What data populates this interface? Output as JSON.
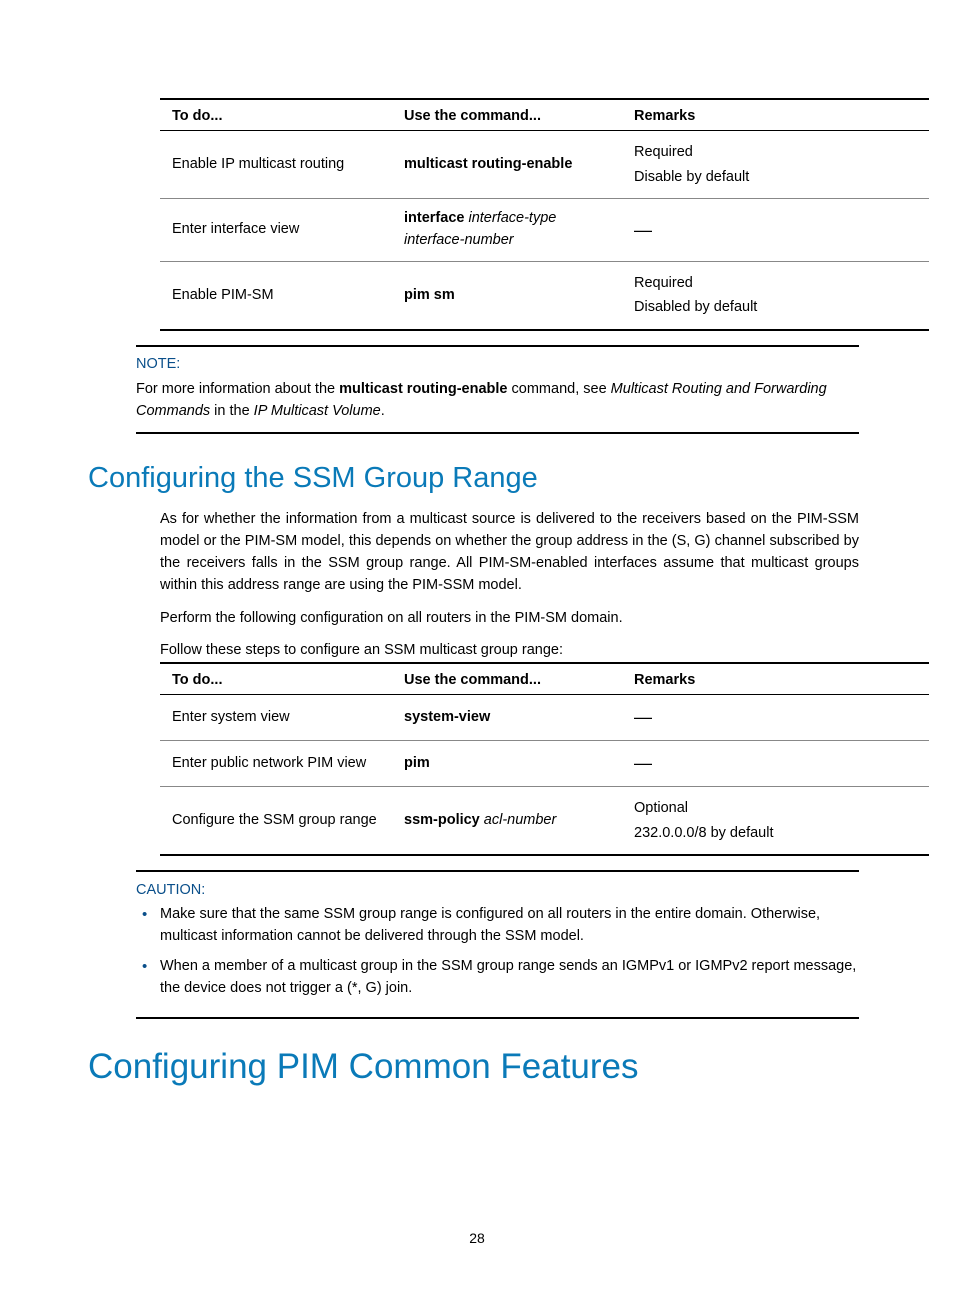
{
  "table1": {
    "headers": {
      "todo": "To do...",
      "cmd": "Use the command...",
      "remarks": "Remarks"
    },
    "rows": [
      {
        "todo": "Enable IP multicast routing",
        "cmd_bold": "multicast routing-enable",
        "cmd_italic": "",
        "remarks_l1": "Required",
        "remarks_l2": "Disable by default"
      },
      {
        "todo": "Enter interface view",
        "cmd_bold": "interface",
        "cmd_italic1": " interface-type",
        "cmd_italic2": "interface-number",
        "remarks_dash": "—"
      },
      {
        "todo": "Enable PIM-SM",
        "cmd_bold": "pim sm",
        "remarks_l1": "Required",
        "remarks_l2": "Disabled by default"
      }
    ]
  },
  "note": {
    "label": "NOTE:",
    "p1a": "For more information about the ",
    "p1b": "multicast routing-enable",
    "p1c": " command, see ",
    "p1d": "Multicast Routing and Forwarding Commands",
    "p1e": " in the ",
    "p1f": "IP Multicast Volume",
    "p1g": "."
  },
  "h2": "Configuring the SSM Group Range",
  "para1": "As for whether the information from a multicast source is delivered to the receivers based on the PIM-SSM model or the PIM-SM model, this depends on whether the group address in the (S, G) channel subscribed by the receivers falls in the SSM group range. All PIM-SM-enabled interfaces assume that multicast groups within this address range are using the PIM-SSM model.",
  "para2": "Perform the following configuration on all routers in the PIM-SM domain.",
  "para3": "Follow these steps to configure an SSM multicast group range:",
  "table2": {
    "headers": {
      "todo": "To do...",
      "cmd": "Use the command...",
      "remarks": "Remarks"
    },
    "rows": [
      {
        "todo": "Enter system view",
        "cmd_bold": "system-view",
        "remarks_dash": "—"
      },
      {
        "todo": "Enter public network PIM view",
        "cmd_bold": "pim",
        "remarks_dash": "—"
      },
      {
        "todo": "Configure the SSM group range",
        "cmd_bold": "ssm-policy",
        "cmd_italic": " acl-number",
        "remarks_l1": "Optional",
        "remarks_l2": "232.0.0.0/8 by default"
      }
    ]
  },
  "caution": {
    "label": "CAUTION:",
    "items": [
      "Make sure that the same SSM group range is configured on all routers in the entire domain. Otherwise, multicast information cannot be delivered through the SSM model.",
      "When a member of a multicast group in the SSM group range sends an IGMPv1 or IGMPv2 report message, the device does not trigger a (*, G) join."
    ]
  },
  "h1": "Configuring PIM Common Features",
  "pageNum": "28"
}
